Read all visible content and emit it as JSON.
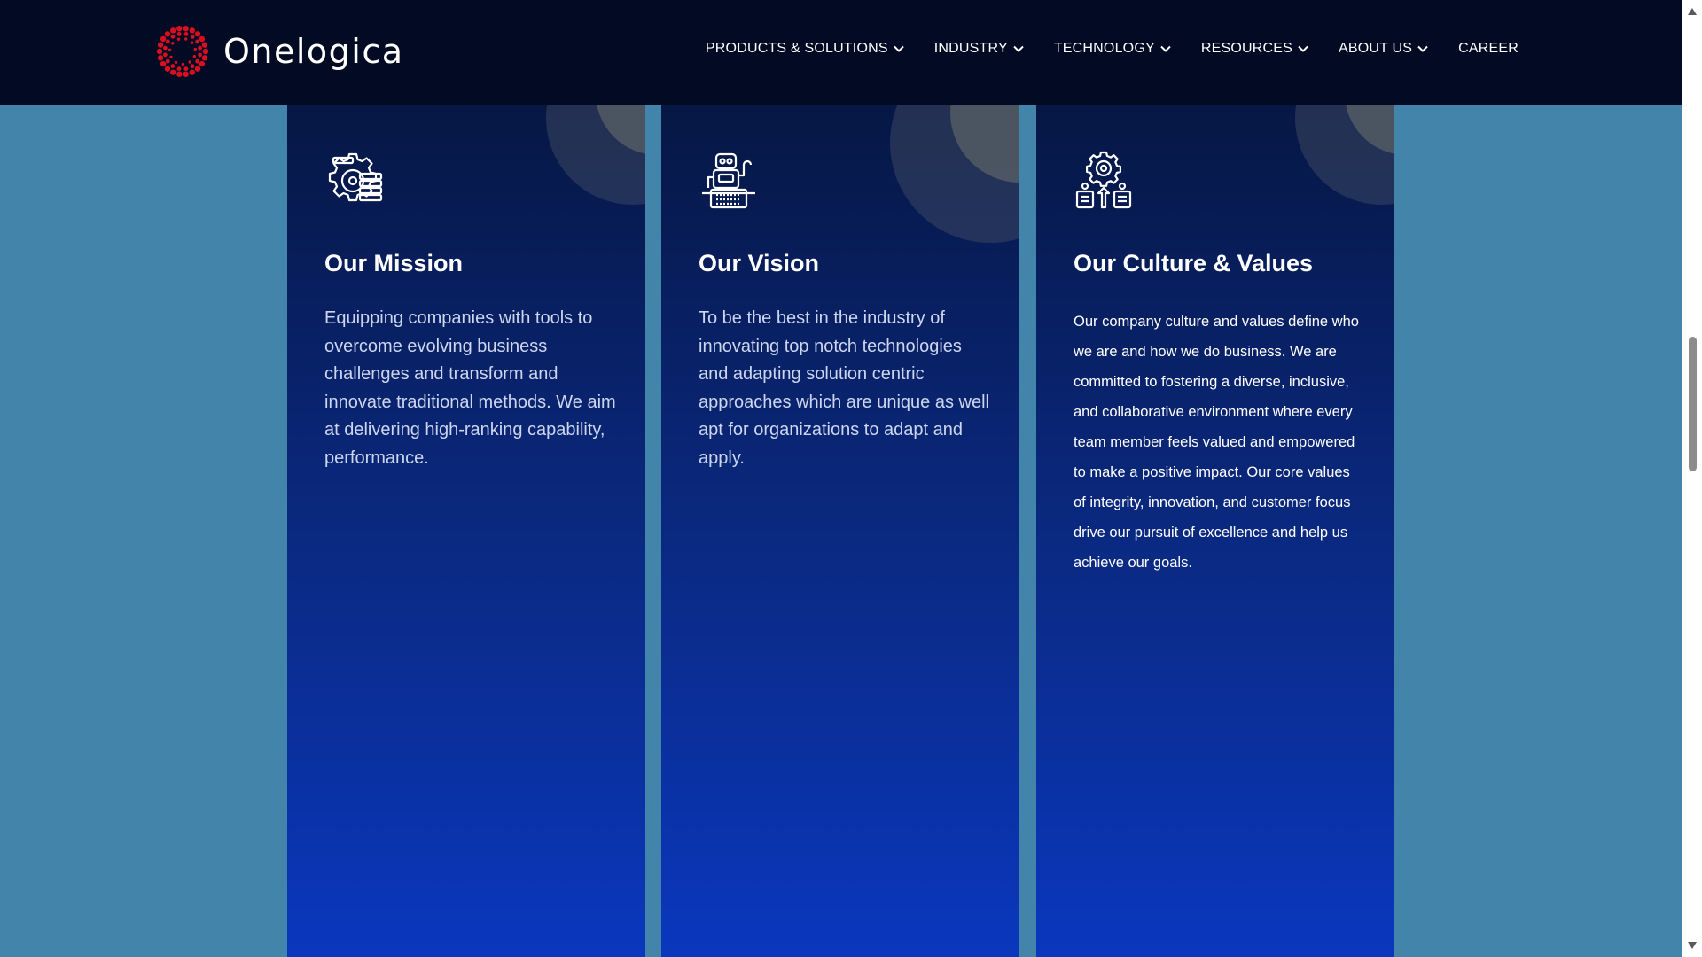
{
  "brand": {
    "name": "Onelogica",
    "logo_color": "#d80f1f"
  },
  "nav": {
    "items": [
      {
        "label": "PRODUCTS & SOLUTIONS",
        "has_dropdown": true
      },
      {
        "label": "INDUSTRY",
        "has_dropdown": true
      },
      {
        "label": "TECHNOLOGY",
        "has_dropdown": true
      },
      {
        "label": "RESOURCES",
        "has_dropdown": true
      },
      {
        "label": "ABOUT US",
        "has_dropdown": true
      },
      {
        "label": "CAREER",
        "has_dropdown": false
      }
    ]
  },
  "cards": [
    {
      "icon": "gear-cog-icon",
      "title": "Our Mission",
      "body": "Equipping companies with tools to overcome evolving business challenges and transform and innovate traditional methods. We aim at delivering high-ranking capability, performance."
    },
    {
      "icon": "robot-icon",
      "title": "Our Vision",
      "body": "To be the best in the industry of innovating top notch technologies and adapting solution centric approaches which are unique as well apt for organizations to adapt and apply."
    },
    {
      "icon": "gear-team-icon",
      "title": "Our Culture & Values",
      "body": "Our company culture and values define who we are and how we do business. We are committed to fostering a diverse, inclusive, and collaborative environment where every team member feels valued and empowered to make a positive impact. Our core values of integrity, innovation, and customer focus drive our pursuit of excellence and help us achieve our goals."
    }
  ],
  "colors": {
    "header_bg": "#020b23",
    "page_bg": "#4384aa",
    "card_top": "#061744",
    "card_bottom": "#0a37be"
  }
}
